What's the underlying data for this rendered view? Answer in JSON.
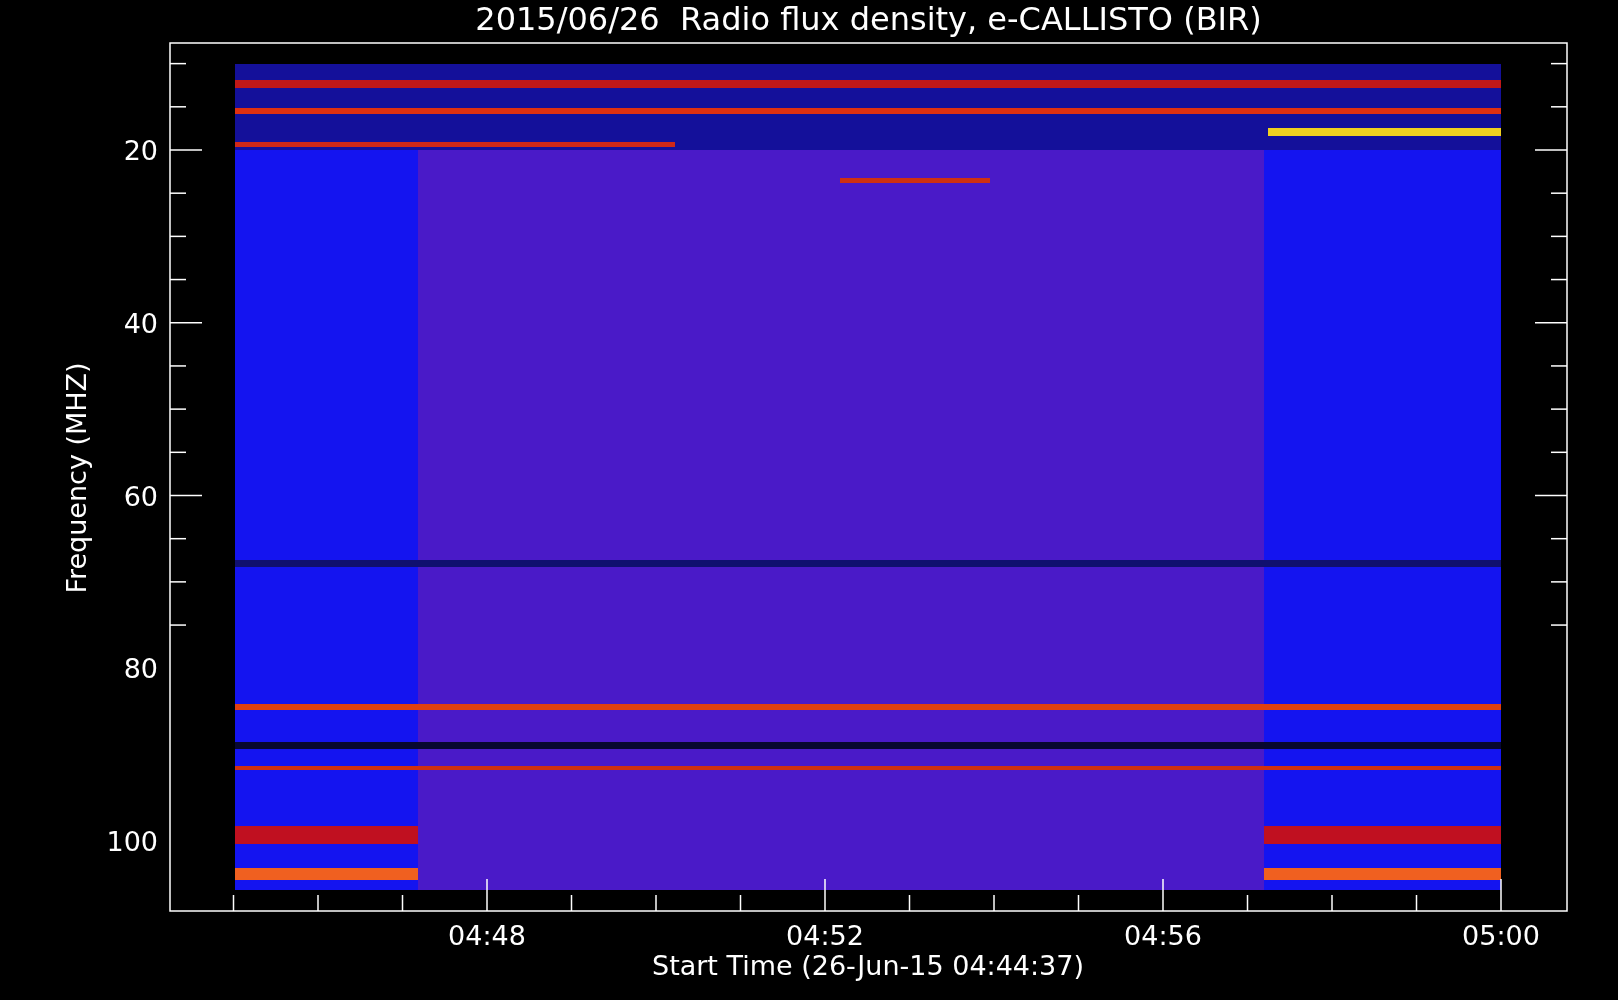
{
  "title": "2015/06/26  Radio flux density, e-CALLISTO (BIR)",
  "y_axis": {
    "label": "Frequency (MHZ)",
    "ticks": [
      "20",
      "40",
      "60",
      "80",
      "100"
    ]
  },
  "x_axis": {
    "label": "Start Time (26-Jun-15 04:44:37)",
    "ticks": [
      "04:48",
      "04:52",
      "04:56",
      "05:00"
    ]
  }
}
